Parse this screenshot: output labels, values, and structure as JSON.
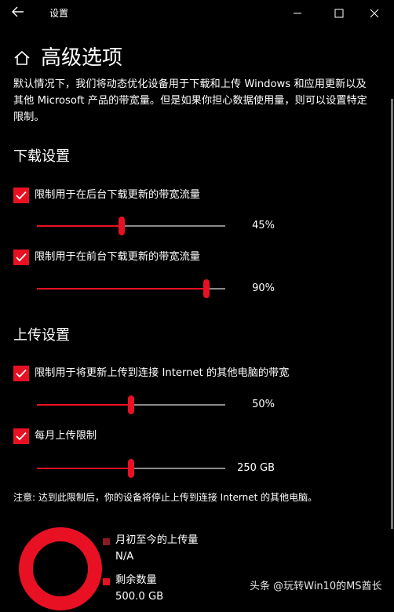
{
  "window": {
    "title": "设置",
    "back_icon": "arrow-left-icon",
    "minimize_icon": "minimize-icon",
    "maximize_icon": "maximize-icon",
    "close_icon": "close-icon"
  },
  "header": {
    "title": "高级选项",
    "icon": "home-icon"
  },
  "intro": "默认情况下，我们将动态优化设备用于下载和上传 Windows 和应用更新以及其他 Microsoft 产品的带宽量。但是如果你担心数据使用量，则可以设置特定限制。",
  "download": {
    "title": "下载设置",
    "options": [
      {
        "label": "限制用于在后台下载更新的带宽流量",
        "checked": true,
        "value_text": "45%",
        "fraction": 0.45
      },
      {
        "label": "限制用于在前台下载更新的带宽流量",
        "checked": true,
        "value_text": "90%",
        "fraction": 0.9
      }
    ]
  },
  "upload": {
    "title": "上传设置",
    "options": [
      {
        "label": "限制用于将更新上传到连接 Internet 的其他电脑的带宽",
        "checked": true,
        "value_text": "50%",
        "fraction": 0.5
      },
      {
        "label": "每月上传限制",
        "checked": true,
        "value_text": "250 GB",
        "fraction": 0.5
      }
    ]
  },
  "note": "注意: 达到此限制后，你的设备将停止上传到连接 Internet 的其他电脑。",
  "usage": {
    "uploaded_label": "月初至今的上传量",
    "uploaded_value": "N/A",
    "remaining_label": "剩余数量",
    "remaining_value": "500.0 GB",
    "uploaded_color": "#8b1a22",
    "remaining_color": "#e81123"
  },
  "watermark": "头条 @玩转Win10的MS酋长",
  "colors": {
    "accent": "#e81123",
    "background": "#000000",
    "track": "#8a8a8a"
  }
}
